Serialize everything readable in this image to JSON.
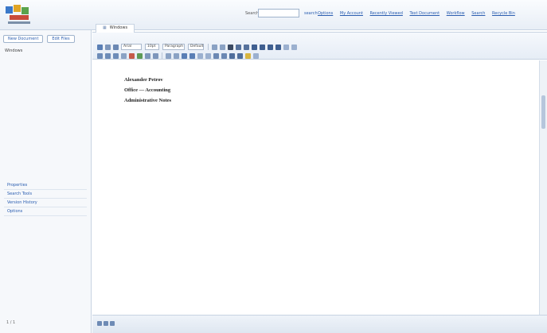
{
  "header": {
    "search_label": "Search",
    "search_button": "search",
    "links": [
      "Options",
      "My Account",
      "Recently Viewed",
      "Text Document",
      "Workflow",
      "Search",
      "Recycle Bin"
    ]
  },
  "sidebar": {
    "buttons": [
      "New Document",
      "Edit Files"
    ],
    "tree": [
      "Windows"
    ],
    "links": [
      "Properties",
      "Search Tools",
      "Version History",
      "Options"
    ],
    "footer": "1 / 1"
  },
  "tab": {
    "label": "Windows"
  },
  "toolbar": {
    "breadcrumb": "",
    "font_family": "Arial",
    "font_size": "10pt",
    "paragraph": "Paragraph",
    "style": "Default"
  },
  "document": {
    "heading_lines": [
      "Alexander Petrov",
      "Office — Accounting",
      "Administrative Notes"
    ],
    "paragraphs": [
      "",
      ""
    ],
    "info_lines": [
      {
        "text": "",
        "bold": true
      },
      {
        "text": "",
        "bold": true
      },
      {
        "text": "",
        "bold": false
      },
      {
        "text": "",
        "bold": true
      },
      {
        "text": "",
        "bold": true
      },
      {
        "text": "",
        "bold": false
      },
      {
        "text": "",
        "bold": true
      }
    ]
  },
  "statusbar": {
    "fields": [
      "",
      "",
      ""
    ]
  },
  "colors": {
    "accent": "#2a5db0",
    "border": "#c7d3e2"
  }
}
